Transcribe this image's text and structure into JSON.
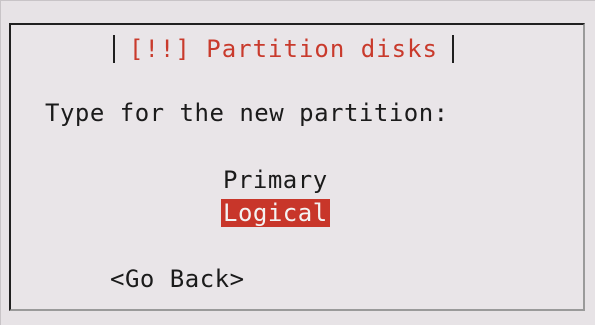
{
  "dialog": {
    "title": "[!!] Partition disks",
    "prompt": "Type for the new partition:",
    "options": [
      {
        "label": "Primary",
        "selected": false
      },
      {
        "label": "Logical",
        "selected": true
      }
    ],
    "go_back_label": "<Go Back>"
  },
  "colors": {
    "title": "#c93a2c",
    "selection_bg": "#c8362a",
    "selection_fg": "#f3f3f3",
    "background": "#e9e5e8"
  }
}
